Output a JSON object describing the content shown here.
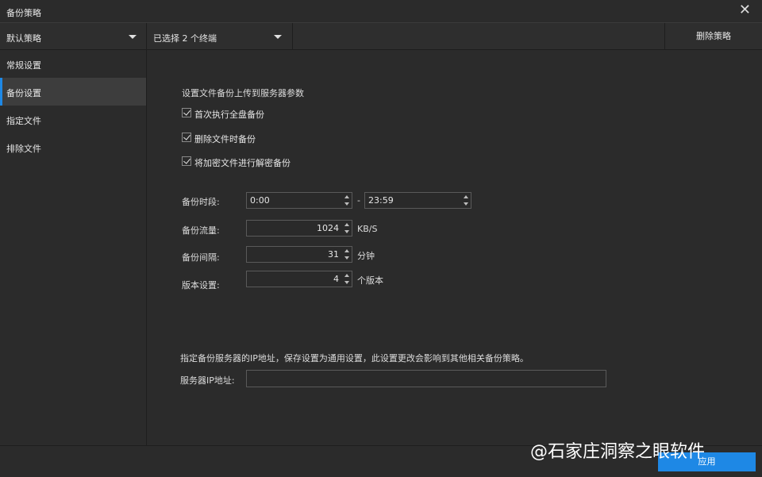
{
  "window": {
    "title": "备份策略",
    "close_glyph": "✕"
  },
  "toolbar": {
    "policy_dropdown": "默认策略",
    "terminal_dropdown": "已选择 2 个终端",
    "delete_button": "删除策略"
  },
  "sidebar": {
    "items": [
      {
        "label": "常规设置",
        "active": false
      },
      {
        "label": "备份设置",
        "active": true
      },
      {
        "label": "指定文件",
        "active": false
      },
      {
        "label": "排除文件",
        "active": false
      }
    ]
  },
  "main": {
    "section_title": "设置文件备份上传到服务器参数",
    "checkboxes": [
      {
        "label": "首次执行全盘备份",
        "checked": true
      },
      {
        "label": "删除文件时备份",
        "checked": true
      },
      {
        "label": "将加密文件进行解密备份",
        "checked": true
      }
    ],
    "backup_period": {
      "label": "备份时段:",
      "start": "0:00",
      "separator": "-",
      "end": "23:59"
    },
    "backup_traffic": {
      "label": "备份流量:",
      "value": "1024",
      "unit": "KB/S"
    },
    "backup_interval": {
      "label": "备份间隔:",
      "value": "31",
      "unit": "分钟"
    },
    "version_setting": {
      "label": "版本设置:",
      "value": "4",
      "unit": "个版本"
    },
    "ip_note": "指定备份服务器的IP地址，保存设置为通用设置，此设置更改会影响到其他相关备份策略。",
    "server_ip": {
      "label": "服务器IP地址:",
      "value": ""
    }
  },
  "footer": {
    "apply_button": "应用"
  },
  "watermark": "@石家庄洞察之眼软件",
  "colors": {
    "accent": "#1e88e5",
    "background": "#2b2b2b"
  }
}
